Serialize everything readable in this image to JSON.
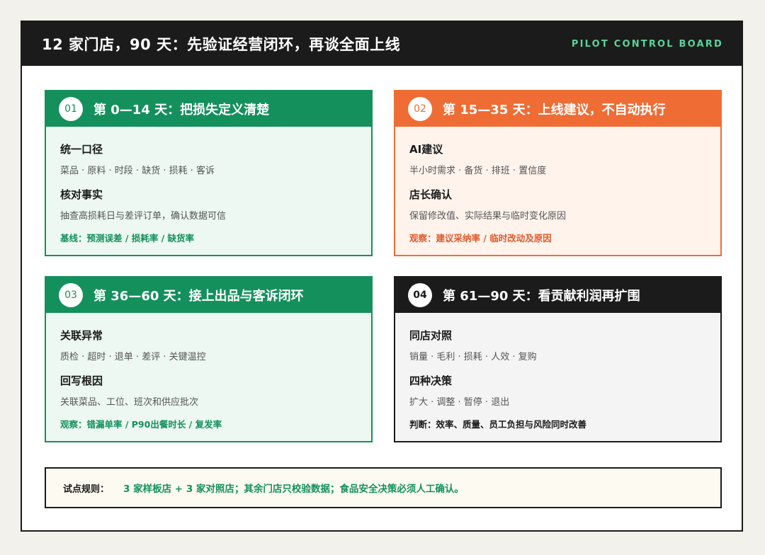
{
  "header": {
    "title": "12 家门店，90 天：先验证经营闭环，再谈全面上线",
    "tag": "PILOT CONTROL BOARD"
  },
  "colors": {
    "green": "#14905c",
    "orange": "#ef6c34",
    "dark": "#1b1b1b",
    "tag_green": "#59d39a"
  },
  "phases": [
    {
      "num": "01",
      "title": "第 0—14 天：把损失定义清楚",
      "sections": [
        {
          "title": "统一口径",
          "text": "菜品 · 原料 · 时段 · 缺货 · 损耗 · 客诉"
        },
        {
          "title": "核对事实",
          "text": "抽查高损耗日与差评订单，确认数据可信"
        }
      ],
      "note": "基线：预测误差 / 损耗率 / 缺货率"
    },
    {
      "num": "02",
      "title": "第 15—35 天：上线建议，不自动执行",
      "sections": [
        {
          "title": "AI建议",
          "text": "半小时需求 · 备货 · 排班 · 置信度"
        },
        {
          "title": "店长确认",
          "text": "保留修改值、实际结果与临时变化原因"
        }
      ],
      "note": "观察：建议采纳率 / 临时改动及原因"
    },
    {
      "num": "03",
      "title": "第 36—60 天：接上出品与客诉闭环",
      "sections": [
        {
          "title": "关联异常",
          "text": "质检 · 超时 · 退单 · 差评 · 关键温控"
        },
        {
          "title": "回写根因",
          "text": "关联菜品、工位、班次和供应批次"
        }
      ],
      "note": "观察：错漏单率 / P90出餐时长 / 复发率"
    },
    {
      "num": "04",
      "title": "第 61—90 天：看贡献利润再扩围",
      "sections": [
        {
          "title": "同店对照",
          "text": "销量 · 毛利 · 损耗 · 人效 · 复购"
        },
        {
          "title": "四种决策",
          "text": "扩大 · 调整 · 暂停 · 退出"
        }
      ],
      "note": "判断：效率、质量、员工负担与风险同时改善"
    }
  ],
  "rule": {
    "label": "试点规则：",
    "text": "3 家样板店 + 3 家对照店；其余门店只校验数据；食品安全决策必须人工确认。"
  }
}
